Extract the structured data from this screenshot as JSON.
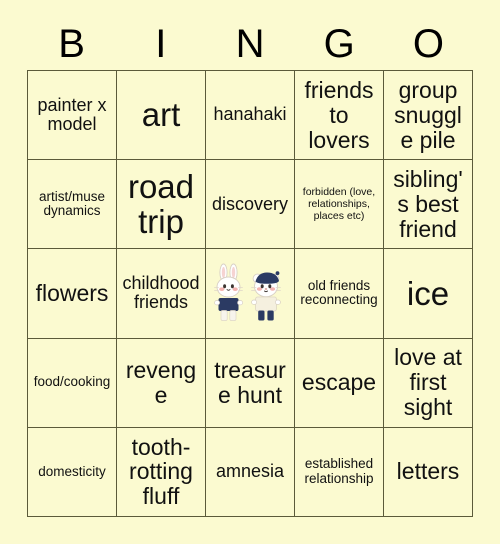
{
  "card": {
    "background_color": "#fbfad0",
    "border_color": "#5b5a3a",
    "text_color": "#111111"
  },
  "header": {
    "letters": [
      "B",
      "I",
      "N",
      "G",
      "O"
    ]
  },
  "grid": {
    "columns": 5,
    "rows": 5,
    "cells": [
      {
        "text": "painter x model",
        "size": "md",
        "row": 1,
        "col": 1
      },
      {
        "text": "art",
        "size": "xl",
        "row": 1,
        "col": 2
      },
      {
        "text": "hanahaki",
        "size": "md",
        "row": 1,
        "col": 3
      },
      {
        "text": "friends to lovers",
        "size": "lg",
        "row": 1,
        "col": 4
      },
      {
        "text": "group snuggle pile",
        "size": "lg",
        "row": 1,
        "col": 5
      },
      {
        "text": "artist/muse dynamics",
        "size": "sm",
        "row": 2,
        "col": 1
      },
      {
        "text": "road trip",
        "size": "xl",
        "row": 2,
        "col": 2
      },
      {
        "text": "discovery",
        "size": "md",
        "row": 2,
        "col": 3
      },
      {
        "text": "forbidden (love, relationships, places etc)",
        "size": "xs",
        "row": 2,
        "col": 4
      },
      {
        "text": "sibling's best friend",
        "size": "lg",
        "row": 2,
        "col": 5
      },
      {
        "text": "flowers",
        "size": "lg",
        "row": 3,
        "col": 1
      },
      {
        "text": "childhood friends",
        "size": "md",
        "row": 3,
        "col": 2
      },
      {
        "text": "",
        "size": "md",
        "row": 3,
        "col": 3,
        "free_space": true,
        "icon": "bunny-and-bear-mascots-icon"
      },
      {
        "text": "old friends reconnecting",
        "size": "sm",
        "row": 3,
        "col": 4
      },
      {
        "text": "ice",
        "size": "xl",
        "row": 3,
        "col": 5
      },
      {
        "text": "food/cooking",
        "size": "sm",
        "row": 4,
        "col": 1
      },
      {
        "text": "revenge",
        "size": "lg",
        "row": 4,
        "col": 2
      },
      {
        "text": "treasure hunt",
        "size": "lg",
        "row": 4,
        "col": 3
      },
      {
        "text": "escape",
        "size": "lg",
        "row": 4,
        "col": 4
      },
      {
        "text": "love at first sight",
        "size": "lg",
        "row": 4,
        "col": 5
      },
      {
        "text": "domesticity",
        "size": "sm",
        "row": 5,
        "col": 1
      },
      {
        "text": "tooth-rotting fluff",
        "size": "lg",
        "row": 5,
        "col": 2
      },
      {
        "text": "amnesia",
        "size": "md",
        "row": 5,
        "col": 3
      },
      {
        "text": "established relationship",
        "size": "sm",
        "row": 5,
        "col": 4
      },
      {
        "text": "letters",
        "size": "lg",
        "row": 5,
        "col": 5
      }
    ]
  },
  "free_space_art": {
    "description": "two cartoon mascots, a white bunny and a white bear wearing a navy beret",
    "bunny": {
      "body_color": "#ffffff",
      "shirt_color": "#2b3a63",
      "pants_color": "#f5f2ea",
      "cheek_color": "#f4b3b0"
    },
    "bear": {
      "body_color": "#ffffff",
      "hat_color": "#2b3a63",
      "shirt_color": "#f5f0df",
      "pants_color": "#2b3a63",
      "cheek_color": "#f4b3b0"
    }
  }
}
